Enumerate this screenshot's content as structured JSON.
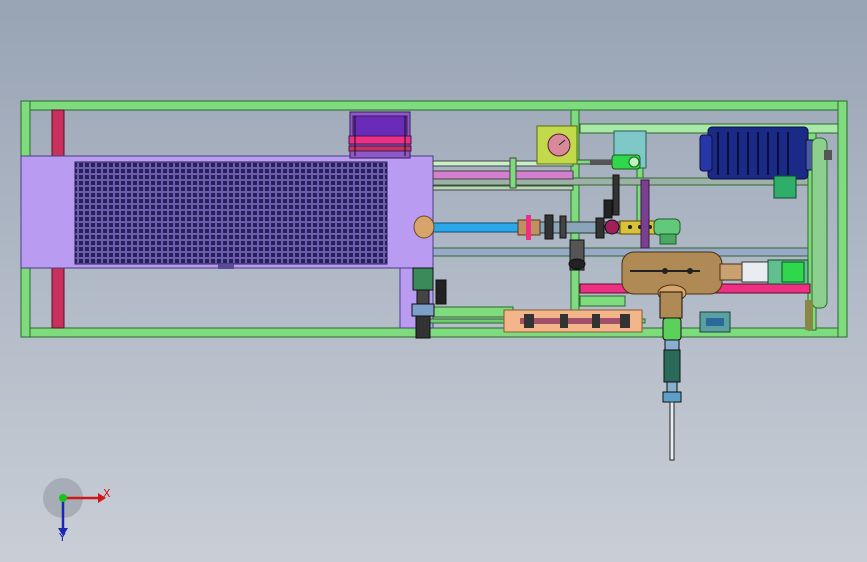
{
  "colors": {
    "background_top": "#98a3b4",
    "background_bottom": "#c9ced6",
    "frame": "#7edb7e",
    "frame_outline": "#2b6a2b",
    "radiator": "#b99cf2",
    "radiator_core": "#463a78",
    "post_red": "#c8315c",
    "pipe_blue": "#2aa7e8",
    "motor_blue": "#1b2a86",
    "tank": "#b08a55",
    "accent_pink": "#ef2f83",
    "accent_purple": "#6a2bb8",
    "peach_plate": "#f2b68a",
    "teal_box": "#7fc8c8"
  },
  "axes": {
    "x_label": "X",
    "y_label": "Y"
  },
  "icons": {
    "triad": "coordinate-triad-icon"
  }
}
